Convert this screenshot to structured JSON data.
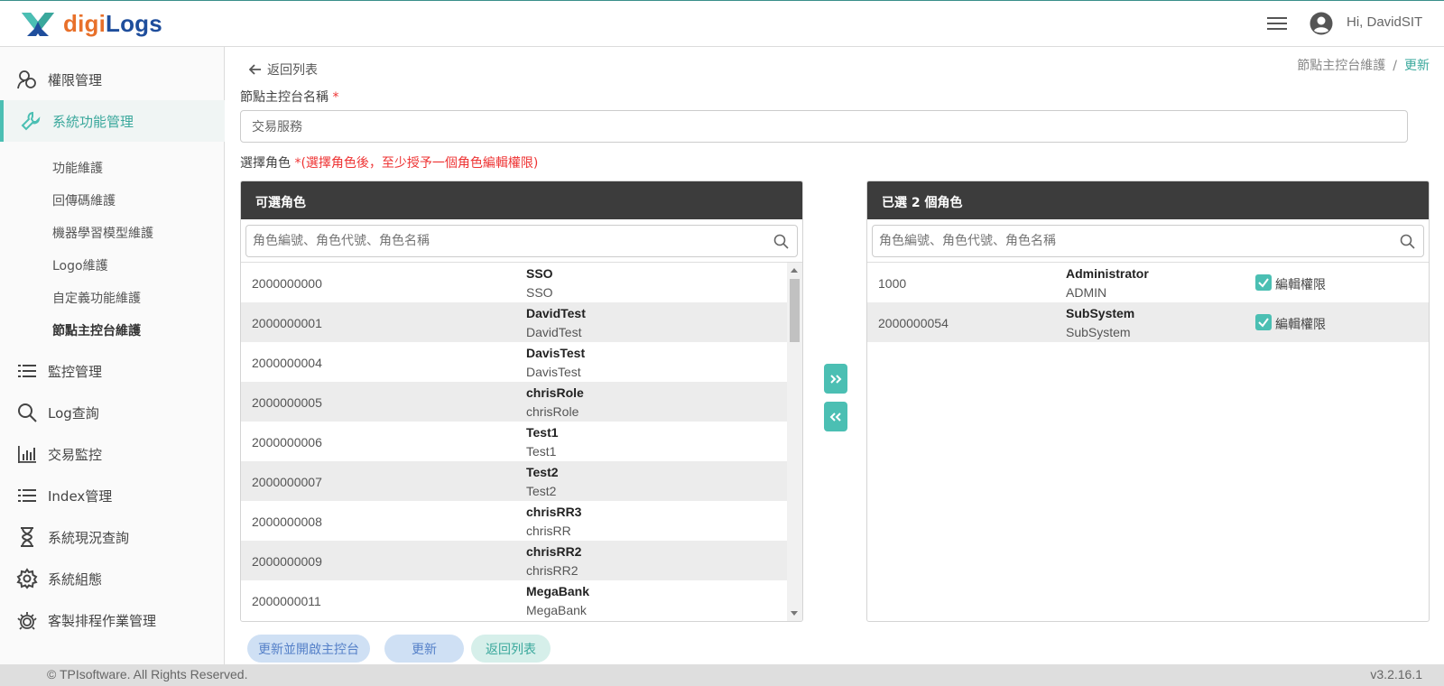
{
  "app": {
    "brand_part1": "digi",
    "brand_part2": "Logs",
    "user_greeting": "Hi, DavidSIT",
    "brand_colors": {
      "orange": "#e8702a",
      "blue": "#1f4e9c",
      "accent": "#4bbfb3"
    }
  },
  "sidebar": {
    "items": [
      {
        "label": "權限管理",
        "icon": "user-group-icon"
      },
      {
        "label": "系統功能管理",
        "icon": "wrench-icon",
        "active": true
      },
      {
        "label": "監控管理",
        "icon": "list-icon"
      },
      {
        "label": "Log查詢",
        "icon": "search-icon"
      },
      {
        "label": "交易監控",
        "icon": "bar-chart-icon"
      },
      {
        "label": "Index管理",
        "icon": "list-icon"
      },
      {
        "label": "系統現況查詢",
        "icon": "hourglass-icon"
      },
      {
        "label": "系統組態",
        "icon": "gear-icon"
      },
      {
        "label": "客製排程作業管理",
        "icon": "gear-cluster-icon"
      }
    ],
    "sub_items": [
      "功能維護",
      "回傳碼維護",
      "機器學習模型維護",
      "Logo維護",
      "自定義功能維護",
      "節點主控台維護"
    ]
  },
  "page": {
    "back_label": "返回列表",
    "breadcrumb_parent": "節點主控台維護",
    "breadcrumb_separator": "/",
    "breadcrumb_current": "更新",
    "name_label": "節點主控台名稱",
    "required_mark": "*",
    "name_value": "交易服務",
    "role_label": "選擇角色",
    "role_hint": "*(選擇角色後，至少授予一個角色編輯權限)"
  },
  "available": {
    "title": "可選角色",
    "search_placeholder": "角色編號、角色代號、角色名稱",
    "rows": [
      {
        "id": "2000000000",
        "name": "SSO",
        "code": "SSO"
      },
      {
        "id": "2000000001",
        "name": "DavidTest",
        "code": "DavidTest"
      },
      {
        "id": "2000000004",
        "name": "DavisTest",
        "code": "DavisTest"
      },
      {
        "id": "2000000005",
        "name": "chrisRole",
        "code": "chrisRole"
      },
      {
        "id": "2000000006",
        "name": "Test1",
        "code": "Test1"
      },
      {
        "id": "2000000007",
        "name": "Test2",
        "code": "Test2"
      },
      {
        "id": "2000000008",
        "name": "chrisRR3",
        "code": "chrisRR"
      },
      {
        "id": "2000000009",
        "name": "chrisRR2",
        "code": "chrisRR2"
      },
      {
        "id": "2000000011",
        "name": "MegaBank",
        "code": "MegaBank"
      }
    ]
  },
  "selected": {
    "title": "已選 2 個角色",
    "search_placeholder": "角色編號、角色代號、角色名稱",
    "edit_label": "編輯權限",
    "rows": [
      {
        "id": "1000",
        "name": "Administrator",
        "code": "ADMIN",
        "edit": true
      },
      {
        "id": "2000000054",
        "name": "SubSystem",
        "code": "SubSystem",
        "edit": true
      }
    ]
  },
  "actions": {
    "add_label": "»",
    "remove_label": "«",
    "update_and_open": "更新並開啟主控台",
    "update": "更新",
    "back": "返回列表"
  },
  "footer": {
    "copyright": "© TPIsoftware. All Rights Reserved.",
    "version": "v3.2.16.1"
  }
}
